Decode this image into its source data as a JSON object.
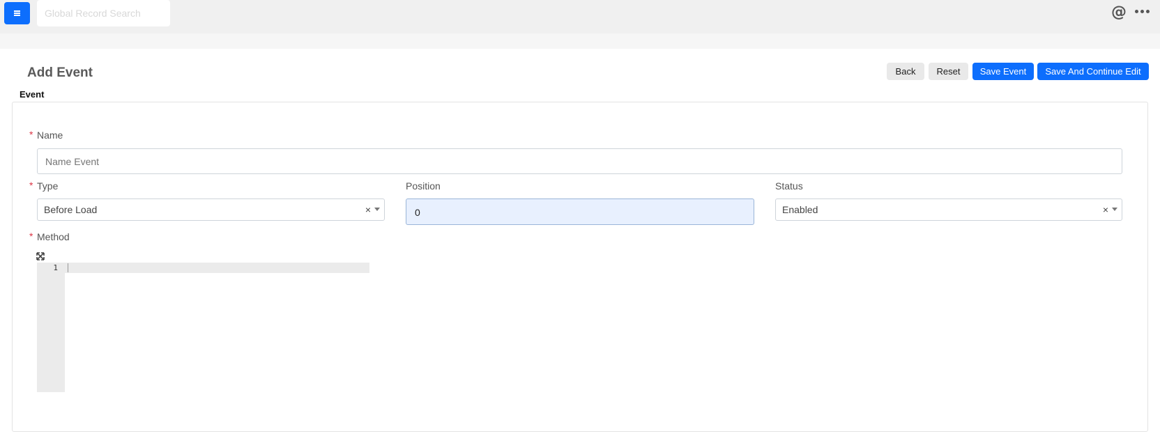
{
  "topbar": {
    "search": {
      "placeholder": "Global Record Search"
    },
    "icons": {
      "menu": "hamburger-menu-icon",
      "mention": "at-sign-icon",
      "more": "more-dots-icon"
    }
  },
  "page": {
    "title": "Add Event",
    "section_label": "Event"
  },
  "toolbar": {
    "back_label": "Back",
    "reset_label": "Reset",
    "save_label": "Save Event",
    "save_continue_label": "Save And Continue Edit"
  },
  "form": {
    "name": {
      "label": "Name",
      "required": true,
      "placeholder": "Name Event",
      "value": ""
    },
    "type": {
      "label": "Type",
      "required": true,
      "value": "Before Load"
    },
    "position": {
      "label": "Position",
      "required": false,
      "value": "0"
    },
    "status": {
      "label": "Status",
      "required": false,
      "value": "Enabled"
    },
    "method": {
      "label": "Method",
      "required": true,
      "line_numbers": [
        "1"
      ]
    }
  },
  "colors": {
    "primary": "#0d6efd",
    "required": "#dc3545",
    "focused_input": "#e8f0fe"
  }
}
